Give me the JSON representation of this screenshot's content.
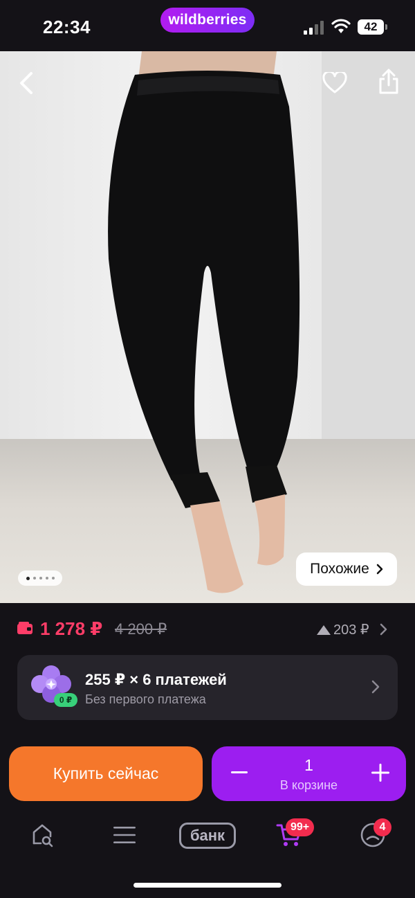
{
  "status_bar": {
    "time": "22:34",
    "brand": "wildberries",
    "battery": "42"
  },
  "product_gallery": {
    "similar_label": "Похожие",
    "dots": [
      1,
      2,
      3,
      4,
      5
    ],
    "active_dot": 0
  },
  "pricing": {
    "price": "1 278 ₽",
    "old_price": "4 200 ₽",
    "price_delta": "203 ₽",
    "price_color": "#ff3d68"
  },
  "installment": {
    "title": "255 ₽ × 6 платежей",
    "subtitle": "Без первого платежа",
    "badge": "0 ₽"
  },
  "actions": {
    "buy_now_label": "Купить сейчас",
    "quantity": "1",
    "in_cart_label": "В корзине",
    "buy_color": "#f5772b",
    "cart_color": "#9c1ef0"
  },
  "tabbar": {
    "bank_label": "банк",
    "cart_badge": "99+",
    "profile_badge": "4",
    "icons": [
      "home-search-icon",
      "menu-icon",
      "bank-icon",
      "cart-icon",
      "profile-icon"
    ]
  }
}
